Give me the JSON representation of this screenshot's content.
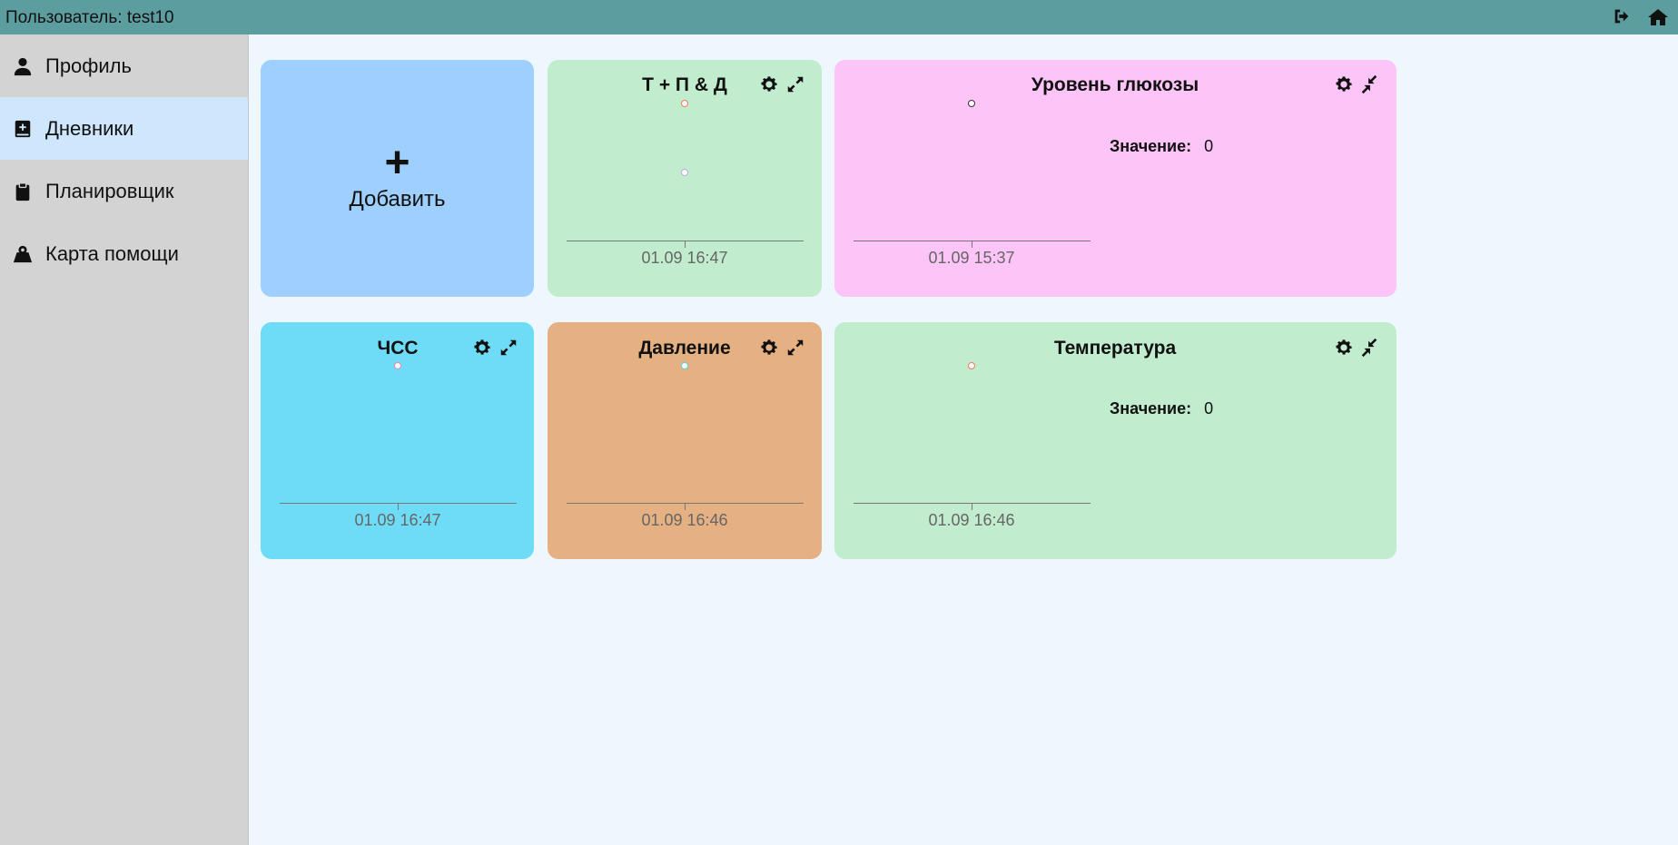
{
  "topbar": {
    "user_label": "Пользователь: test10",
    "icons": [
      "logout-icon",
      "home-icon"
    ],
    "color": "#5c9ea0"
  },
  "sidebar": {
    "items": [
      {
        "label": "Профиль",
        "icon": "user-icon",
        "active": false
      },
      {
        "label": "Дневники",
        "icon": "diary-icon",
        "active": true
      },
      {
        "label": "Планировщик",
        "icon": "clipboard-icon",
        "active": false
      },
      {
        "label": "Карта помощи",
        "icon": "map-marker-icon",
        "active": false
      }
    ]
  },
  "add_card": {
    "plus": "+",
    "label": "Добавить",
    "color": "#9ecffd"
  },
  "cards": [
    {
      "title": "Т + П & Д",
      "color": "#c1ecce",
      "date": "01.09 16:47",
      "toggle_icon": "expand-icon",
      "points": [
        {
          "color": "#f07a5a"
        },
        {
          "color": "#c9a0f0"
        }
      ]
    },
    {
      "title": "Уровень глюкозы",
      "color": "#fdc4f7",
      "date": "01.09 15:37",
      "toggle_icon": "compress-icon",
      "value_label": "Значение:",
      "value": "0",
      "points": [
        {
          "color": "#333333"
        }
      ]
    },
    {
      "title": "ЧСС",
      "color": "#6fdcf7",
      "date": "01.09 16:47",
      "toggle_icon": "expand-icon",
      "points": [
        {
          "color": "#e08ab0"
        }
      ]
    },
    {
      "title": "Давление",
      "color": "#e5b082",
      "date": "01.09 16:46",
      "toggle_icon": "expand-icon",
      "points": [
        {
          "color": "#58d4e0"
        }
      ]
    },
    {
      "title": "Температура",
      "color": "#c1ecce",
      "date": "01.09 16:46",
      "toggle_icon": "compress-icon",
      "value_label": "Значение:",
      "value": "0",
      "points": [
        {
          "color": "#f07a5a"
        }
      ]
    }
  ]
}
